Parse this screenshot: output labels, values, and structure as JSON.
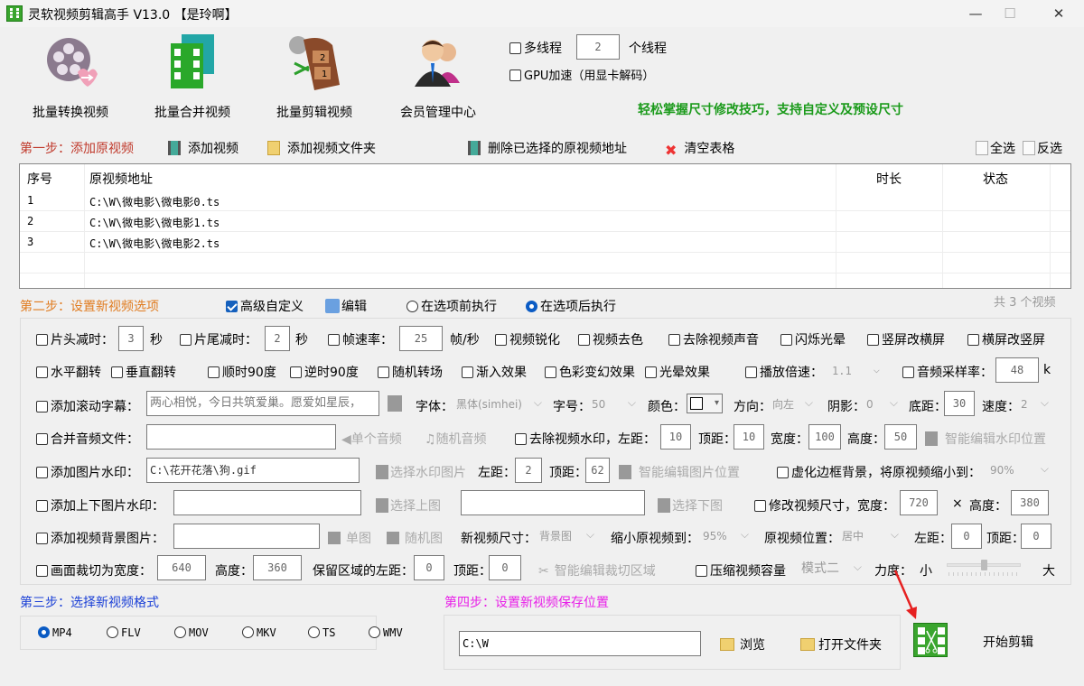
{
  "window": {
    "title": "灵软视频剪辑高手 V13.0  【是玲啊】",
    "minimize": "—",
    "maximize": "☐",
    "close": "✕"
  },
  "toolbar": {
    "items": [
      {
        "label": "批量转换视频",
        "icon": "film-reel-icon"
      },
      {
        "label": "批量合并视频",
        "icon": "film-merge-icon"
      },
      {
        "label": "批量剪辑视频",
        "icon": "film-cut-icon"
      },
      {
        "label": "会员管理中心",
        "icon": "users-icon"
      }
    ],
    "multithread_label": "多线程",
    "multithread_checked": false,
    "thread_count": "2",
    "thread_unit": "个线程",
    "gpu_label": "GPU加速（用显卡解码）",
    "gpu_checked": false,
    "tip": "轻松掌握尺寸修改技巧，支持自定义及预设尺寸"
  },
  "step1": {
    "title": "第一步：添加原视频",
    "add_video": "添加视频",
    "add_folder": "添加视频文件夹",
    "delete_selected": "删除已选择的原视频地址",
    "clear_table": "清空表格",
    "select_all": "全选",
    "invert_select": "反选",
    "columns": [
      "序号",
      "原视频地址",
      "时长",
      "状态"
    ],
    "rows": [
      {
        "index": "1",
        "path": "C:\\W\\微电影\\微电影0.ts",
        "duration": "",
        "status": ""
      },
      {
        "index": "2",
        "path": "C:\\W\\微电影\\微电影1.ts",
        "duration": "",
        "status": ""
      },
      {
        "index": "3",
        "path": "C:\\W\\微电影\\微电影2.ts",
        "duration": "",
        "status": ""
      }
    ],
    "count_text": "共 3 个视频"
  },
  "step2": {
    "title": "第二步：设置新视频选项",
    "advanced_label": "高级自定义",
    "advanced_checked": true,
    "edit_label": "编辑",
    "before_label": "在选项前执行",
    "after_label": "在选项后执行",
    "exec_mode": "after",
    "row1": {
      "head_trim": "片头减时：",
      "head_value": "3",
      "sec1": "秒",
      "tail_trim": "片尾减时：",
      "tail_value": "2",
      "sec2": "秒",
      "fps": "帧速率：",
      "fps_value": "25",
      "fps_unit": "帧/秒",
      "sharpen": "视频锐化",
      "decolor": "视频去色",
      "mute": "去除视频声音",
      "flash": "闪烁光晕",
      "v2h": "竖屏改横屏",
      "h2v": "横屏改竖屏"
    },
    "row2": {
      "hflip": "水平翻转",
      "vflip": "垂直翻转",
      "cw90": "顺时90度",
      "ccw90": "逆时90度",
      "transition": "随机转场",
      "fadein": "渐入效果",
      "color_fx": "色彩变幻效果",
      "halo": "光晕效果",
      "speed": "播放倍速：",
      "speed_value": "1.1",
      "sample_rate": "音频采样率：",
      "sample_value": "48",
      "sample_unit": "k"
    },
    "row3": {
      "scroll_text": "添加滚动字幕：",
      "scroll_value": "两心相悦，今日共筑爱巢。愿爱如星辰，",
      "font": "字体：",
      "font_value": "黑体(simhei)",
      "size": "字号：",
      "size_value": "50",
      "color": "颜色：",
      "direction": "方向：",
      "direction_value": "向左",
      "shadow": "阴影：",
      "shadow_value": "0",
      "bottom": "底距：",
      "bottom_value": "30",
      "speed": "速度：",
      "speed_value": "2"
    },
    "row4": {
      "merge_audio": "合并音频文件：",
      "merge_value": "",
      "single_audio": "单个音频",
      "random_audio": "随机音频",
      "remove_wm": "去除视频水印，左距：",
      "wm_left": "10",
      "top": "顶距：",
      "wm_top": "10",
      "width": "宽度：",
      "wm_width": "100",
      "height": "高度：",
      "wm_height": "50",
      "smart_wm": "智能编辑水印位置"
    },
    "row5": {
      "img_wm": "添加图片水印：",
      "img_value": "C:\\花开花落\\狗.gif",
      "choose_wm": "选择水印图片",
      "left": "左距：",
      "left_value": "2",
      "top": "顶距：",
      "top_value": "62",
      "smart_img": "智能编辑图片位置",
      "blur_bg": "虚化边框背景，将原视频缩小到：",
      "blur_value": "90%"
    },
    "row6": {
      "tb_wm": "添加上下图片水印：",
      "top_value": "",
      "choose_top": "选择上图",
      "bottom_value": "",
      "choose_bottom": "选择下图",
      "resize": "修改视频尺寸，宽度：",
      "width_value": "720",
      "times": "×",
      "height": "高度：",
      "height_value": "380"
    },
    "row7": {
      "bg_img": "添加视频背景图片：",
      "bg_value": "",
      "single": "单图",
      "random": "随机图",
      "new_size": "新视频尺寸：",
      "new_size_value": "背景图",
      "shrink": "缩小原视频到：",
      "shrink_value": "95%",
      "position": "原视频位置：",
      "position_value": "居中",
      "left": "左距：",
      "left_value": "0",
      "top": "顶距：",
      "top_value": "0"
    },
    "row8": {
      "crop": "画面裁切为宽度：",
      "crop_width": "640",
      "height": "高度：",
      "crop_height": "360",
      "keep_left": "保留区域的左距：",
      "keep_left_value": "0",
      "top": "顶距：",
      "top_value": "0",
      "smart_crop": "智能编辑裁切区域",
      "compress": "压缩视频容量",
      "compress_mode": "模式二",
      "strength": "力度：",
      "small": "小",
      "large": "大",
      "strength_value": 0.5
    }
  },
  "step3": {
    "title": "第三步：选择新视频格式",
    "formats": [
      "MP4",
      "FLV",
      "MOV",
      "MKV",
      "TS",
      "WMV"
    ],
    "selected": "MP4"
  },
  "step4": {
    "title": "第四步：设置新视频保存位置",
    "path": "C:\\W",
    "browse": "浏览",
    "open_folder": "打开文件夹"
  },
  "start_label": "开始剪辑",
  "colors": {
    "step1": "#c0392b",
    "step2": "#e07b1f",
    "step3": "#1a3fd6",
    "step4": "#e81fe8",
    "tip": "#1a9a1a",
    "accent": "#1560bd"
  }
}
